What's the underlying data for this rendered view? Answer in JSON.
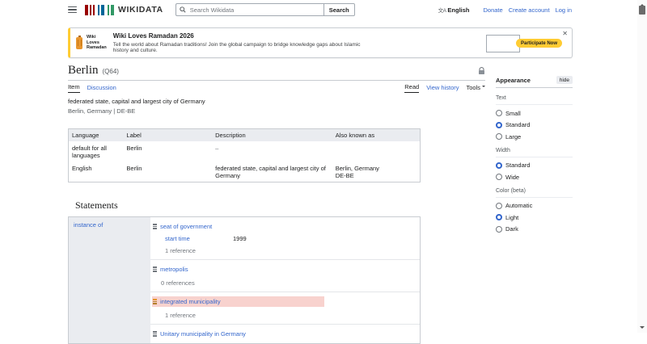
{
  "header": {
    "logo_text": "WIKIDATA",
    "search": {
      "placeholder": "Search Wikidata",
      "button": "Search"
    },
    "language_icon": "文A",
    "language": "English",
    "links": [
      "Donate",
      "Create account",
      "Log in"
    ]
  },
  "banner": {
    "badge_lines": [
      "Wiki",
      "Loves",
      "Ramadan"
    ],
    "title": "Wiki Loves Ramadan 2026",
    "subtitle": "Tell the world about Ramadan traditions! Join the global campaign to bridge knowledge gaps about Islamic history and culture.",
    "cta": "Participate Now",
    "close": "✕"
  },
  "page": {
    "title": "Berlin",
    "qid": "(Q64)",
    "tabs_left": [
      "Item",
      "Discussion"
    ],
    "tabs_right": [
      "Read",
      "View history",
      "Tools"
    ],
    "description": "federated state, capital and largest city of Germany",
    "alias_line": "Berlin, Germany | DE-BE"
  },
  "terms_table": {
    "headers": [
      "Language",
      "Label",
      "Description",
      "Also known as"
    ],
    "rows": [
      {
        "language": "default for all languages",
        "label": "Berlin",
        "description": "–",
        "aliases": [
          "",
          ""
        ]
      },
      {
        "language": "English",
        "label": "Berlin",
        "description": "federated state, capital and largest city of Germany",
        "aliases": [
          "Berlin, Germany",
          "DE-BE"
        ]
      }
    ]
  },
  "statements": {
    "heading": "Statements",
    "property": "instance of",
    "claims": [
      {
        "value": "seat of government",
        "qualifiers": [
          {
            "property": "start time",
            "value": "1999"
          }
        ],
        "references": "1 reference",
        "deprecated": false
      },
      {
        "value": "metropolis",
        "references": "0 references",
        "deprecated": false
      },
      {
        "value": "integrated municipality",
        "references": "1 reference",
        "deprecated": true
      },
      {
        "value": "Unitary municipality in Germany",
        "references": "",
        "deprecated": false
      }
    ]
  },
  "appearance": {
    "title": "Appearance",
    "hide": "hide",
    "sections": [
      {
        "label": "Text",
        "options": [
          {
            "label": "Small",
            "checked": false
          },
          {
            "label": "Standard",
            "checked": true
          },
          {
            "label": "Large",
            "checked": false
          }
        ]
      },
      {
        "label": "Width",
        "options": [
          {
            "label": "Standard",
            "checked": true
          },
          {
            "label": "Wide",
            "checked": false
          }
        ]
      },
      {
        "label": "Color (beta)",
        "options": [
          {
            "label": "Automatic",
            "checked": false
          },
          {
            "label": "Light",
            "checked": true
          },
          {
            "label": "Dark",
            "checked": false
          }
        ]
      }
    ]
  },
  "colors": {
    "link": "#3366cc",
    "accent_radio": "#3366cc",
    "banner_yellow": "#ffcc33",
    "deprecated_bg": "#f8d2ce",
    "table_header_bg": "#eaecf0",
    "logo_red": "#990000",
    "logo_blue": "#006699",
    "logo_green": "#339966"
  }
}
